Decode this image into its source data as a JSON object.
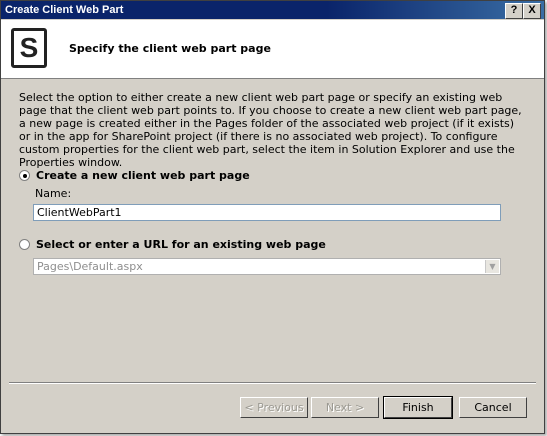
{
  "window": {
    "title": "Create Client Web Part",
    "help_label": "?",
    "close_label": "X"
  },
  "header": {
    "logo_letter": "S",
    "title": "Specify the client web part page"
  },
  "description": "Select the option to either create a new client web part page or specify an existing web page that the client web part points to. If you choose to create a new client web part page, a new page is created either in the Pages folder of the associated web project (if it exists) or in the app for SharePoint project (if there is no associated web project). To configure custom properties for the client web part, select the item in Solution Explorer and use the Properties window.",
  "option_new": {
    "label": "Create a new client web part page",
    "selected": true,
    "name_label": "Name:",
    "name_value": "ClientWebPart1"
  },
  "option_existing": {
    "label": "Select or enter a URL for an existing web page",
    "selected": false,
    "url_value": "Pages\\Default.aspx"
  },
  "buttons": {
    "previous": "< Previous",
    "next": "Next >",
    "finish": "Finish",
    "cancel": "Cancel"
  }
}
